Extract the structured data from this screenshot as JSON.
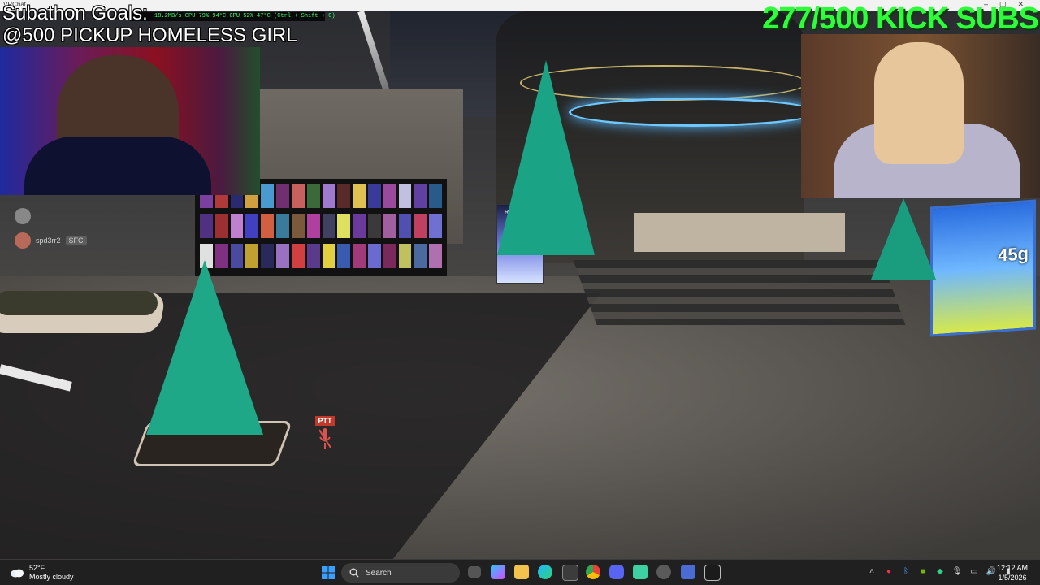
{
  "window": {
    "title": "VRChat"
  },
  "overlay": {
    "goals_title": "Subathon Goals:",
    "goals_item": "@500 PICKUP HOMELESS GIRL",
    "subs_counter": "277/500 KICK SUBS",
    "perf_readout": "18.2MB/s  CPU 79% 94°C  GPU 52% 47°C  (Ctrl + Shift + O)"
  },
  "game": {
    "player_list": [
      {
        "name": "",
        "tag": ""
      },
      {
        "name": "spd3rr2",
        "tag": "SFC"
      }
    ],
    "ptt_label": "PTT",
    "poster_text": "REVENANT",
    "ad_price": "45g"
  },
  "taskbar": {
    "weather_temp": "52°F",
    "weather_desc": "Mostly cloudy",
    "search_label": "Search",
    "time": "12:12 AM",
    "date": "1/5/2026"
  },
  "colors": {
    "subs_green": "#2cff3a",
    "tree_teal": "#1fa888",
    "taskbar_bg": "#202020"
  }
}
